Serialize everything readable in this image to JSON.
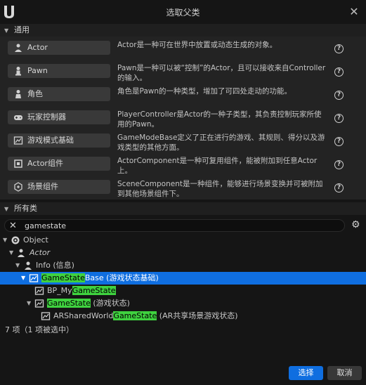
{
  "window": {
    "title": "选取父类"
  },
  "common": {
    "header": "通用",
    "items": [
      {
        "label": "Actor",
        "desc": "Actor是一种可在世界中放置或动态生成的对象。",
        "icon": "actor-icon"
      },
      {
        "label": "Pawn",
        "desc": "Pawn是一种可以被“控制”的Actor，且可以接收来自Controller的输入。",
        "icon": "pawn-icon"
      },
      {
        "label": "角色",
        "desc": "角色是Pawn的一种类型，增加了可四处走动的功能。",
        "icon": "character-icon"
      },
      {
        "label": "玩家控制器",
        "desc": "PlayerController是Actor的一种子类型，其负责控制玩家所使用的Pawn。",
        "icon": "gamepad-icon"
      },
      {
        "label": "游戏模式基础",
        "desc": "GameModeBase定义了正在进行的游戏、其规则、得分以及游戏类型的其他方面。",
        "icon": "game-mode-icon"
      },
      {
        "label": "Actor组件",
        "desc": "ActorComponent是一种可复用组件，能被附加到任意Actor上。",
        "icon": "component-icon"
      },
      {
        "label": "场景组件",
        "desc": "SceneComponent是一种组件，能够进行场景变换并可被附加到其他场景组件下。",
        "icon": "scene-component-icon"
      }
    ]
  },
  "all_classes": {
    "header": "所有类",
    "search_value": "gamestate",
    "tree": [
      {
        "pre": "Object",
        "hl": "",
        "post": ""
      },
      {
        "pre": "Actor",
        "hl": "",
        "post": ""
      },
      {
        "pre": "Info (信息)",
        "hl": "",
        "post": ""
      },
      {
        "pre": "",
        "hl": "GameState",
        "post": "Base (游戏状态基础)"
      },
      {
        "pre": "BP_My",
        "hl": "GameState",
        "post": ""
      },
      {
        "pre": "",
        "hl": "GameState",
        "post": " (游戏状态)"
      },
      {
        "pre": "ARSharedWorld",
        "hl": "GameState",
        "post": " (AR共享场景游戏状态)"
      }
    ],
    "count_text": "7 项（1 项被选中）"
  },
  "buttons": {
    "select": "选择",
    "cancel": "取消"
  },
  "colors": {
    "accent": "#0f6ee0",
    "highlight": "#3fd23f",
    "background": "#151515"
  }
}
